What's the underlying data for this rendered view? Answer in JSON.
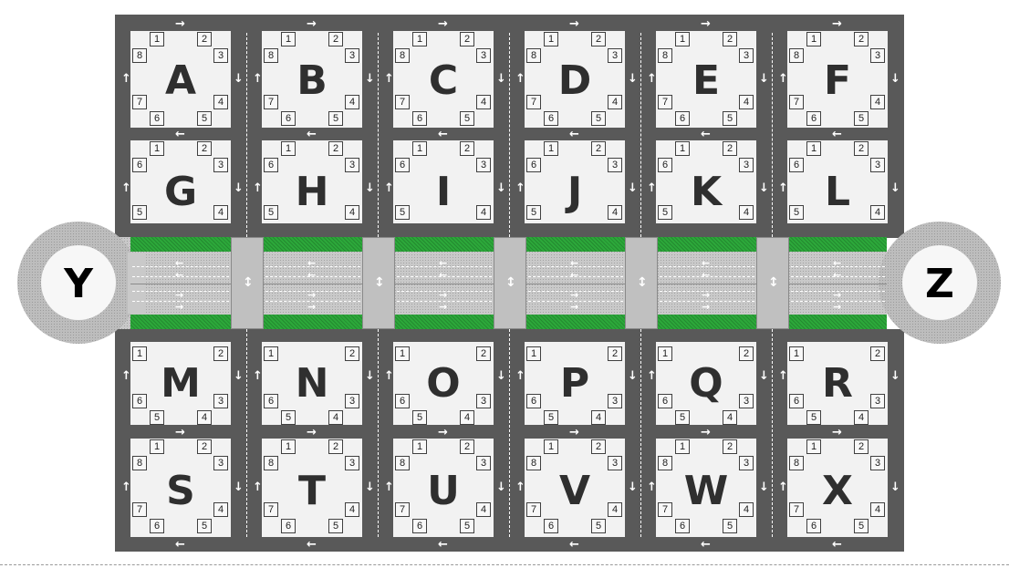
{
  "colors": {
    "road": "#595959",
    "block": "#f2f2f2",
    "green": "#2ca83a",
    "median": "#c9c9c9",
    "hub": "#bdbdbd"
  },
  "hubs": {
    "left": "Y",
    "right": "Z"
  },
  "top_blocks": [
    {
      "row1": "A",
      "row2": "G"
    },
    {
      "row1": "B",
      "row2": "H"
    },
    {
      "row1": "C",
      "row2": "I"
    },
    {
      "row1": "D",
      "row2": "J"
    },
    {
      "row1": "E",
      "row2": "K"
    },
    {
      "row1": "F",
      "row2": "L"
    }
  ],
  "bottom_blocks": [
    {
      "row1": "M",
      "row2": "S"
    },
    {
      "row1": "N",
      "row2": "T"
    },
    {
      "row1": "O",
      "row2": "U"
    },
    {
      "row1": "P",
      "row2": "V"
    },
    {
      "row1": "Q",
      "row2": "W"
    },
    {
      "row1": "R",
      "row2": "X"
    }
  ],
  "slot_labels_8": [
    "1",
    "2",
    "3",
    "4",
    "5",
    "6",
    "7",
    "8"
  ],
  "slot_labels_6": [
    "1",
    "2",
    "3",
    "4",
    "5",
    "6"
  ],
  "arrow_glyphs": {
    "right": "→",
    "left": "←",
    "up": "↑",
    "down": "↓",
    "both": "↕"
  }
}
